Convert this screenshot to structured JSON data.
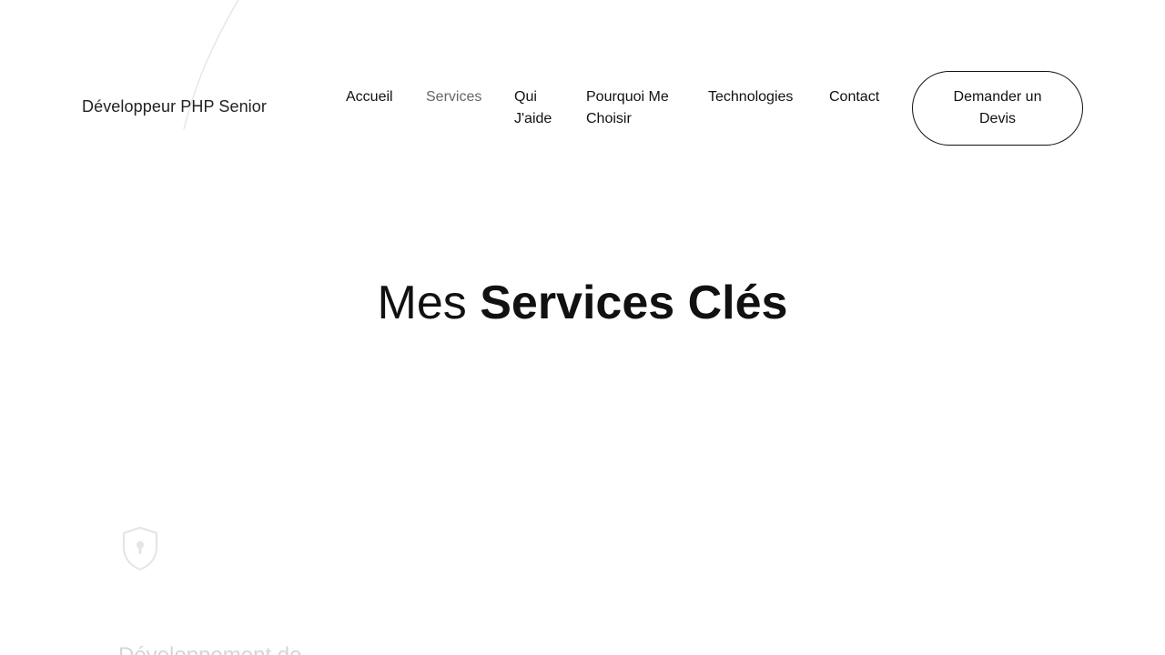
{
  "header": {
    "brand": "Développeur PHP Senior",
    "nav": {
      "accueil": "Accueil",
      "services": "Services",
      "qui": "Qui J'aide",
      "pourquoi": "Pourquoi Me Choisir",
      "technologies": "Technologies",
      "contact": "Contact"
    },
    "cta": "Demander un Devis"
  },
  "section": {
    "title_light": "Mes",
    "title_bold": "Services Clés"
  },
  "services": [
    {
      "icon": "shield-lock-icon",
      "title": "Développement de"
    }
  ],
  "colors": {
    "text": "#111111",
    "nav_active": "#666666",
    "background": "#ffffff"
  }
}
